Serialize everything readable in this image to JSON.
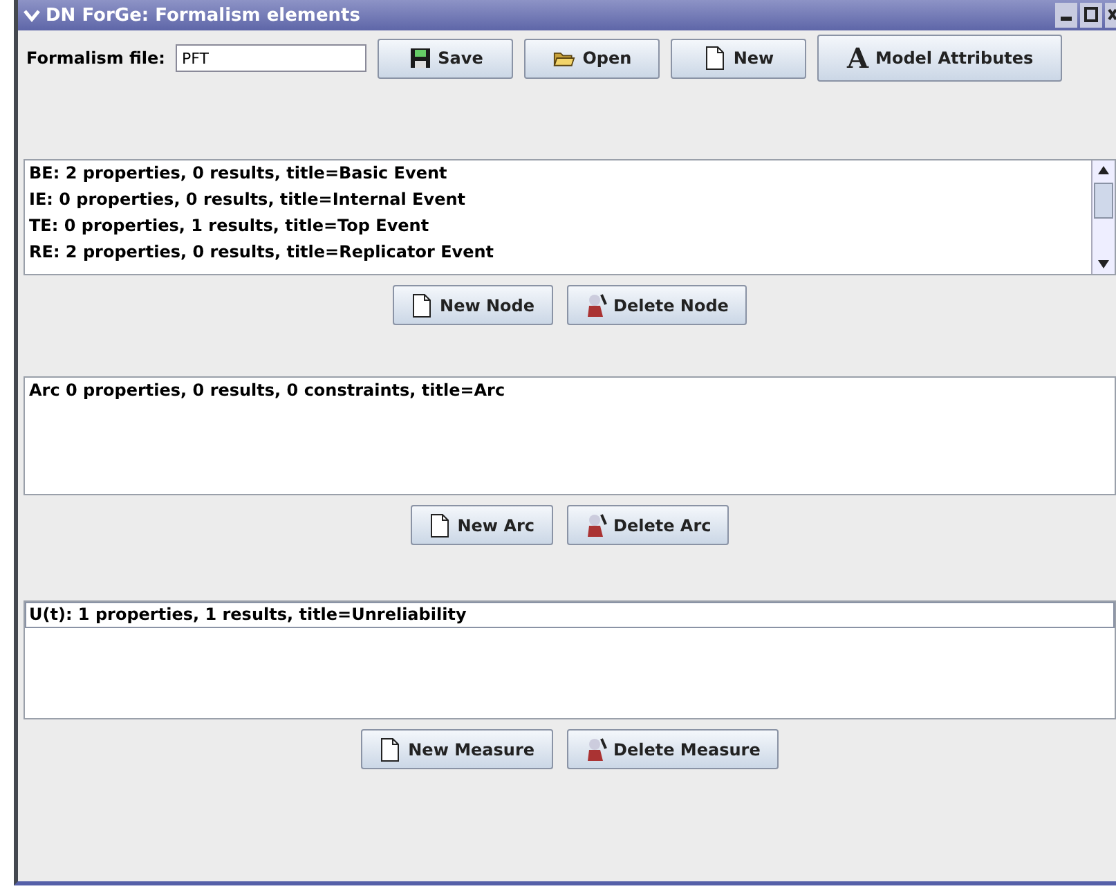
{
  "window": {
    "title": "DN ForGe: Formalism elements"
  },
  "toolbar": {
    "file_label": "Formalism file:",
    "file_value": "PFT",
    "buttons": [
      {
        "kind": "save",
        "label": "Save"
      },
      {
        "kind": "open",
        "label": "Open"
      },
      {
        "kind": "new",
        "label": "New"
      },
      {
        "kind": "letter",
        "glyph": "A",
        "label": "Model Attributes"
      }
    ]
  },
  "sections": [
    {
      "kind": "scroll",
      "items": [
        {
          "text": "BE: 2 properties, 0 results, title=Basic Event",
          "selected": false
        },
        {
          "text": "IE: 0 properties, 0 results, title=Internal Event",
          "selected": false
        },
        {
          "text": "TE: 0 properties, 1 results, title=Top Event",
          "selected": false
        },
        {
          "text": "RE: 2 properties, 0 results, title=Replicator Event",
          "selected": false
        }
      ],
      "buttons": [
        {
          "kind": "new",
          "label": "New Node"
        },
        {
          "kind": "delete",
          "label": "Delete Node"
        }
      ]
    },
    {
      "kind": "plain",
      "items": [
        {
          "text": "Arc 0 properties, 0 results, 0 constraints, title=Arc",
          "selected": false
        }
      ],
      "buttons": [
        {
          "kind": "new",
          "label": "New Arc"
        },
        {
          "kind": "delete",
          "label": "Delete Arc"
        }
      ]
    },
    {
      "kind": "plain",
      "items": [
        {
          "text": "U(t): 1 properties, 1 results, title=Unreliability",
          "selected": true
        }
      ],
      "buttons": [
        {
          "kind": "new",
          "label": "New Measure"
        },
        {
          "kind": "delete",
          "label": "Delete Measure"
        }
      ]
    }
  ]
}
